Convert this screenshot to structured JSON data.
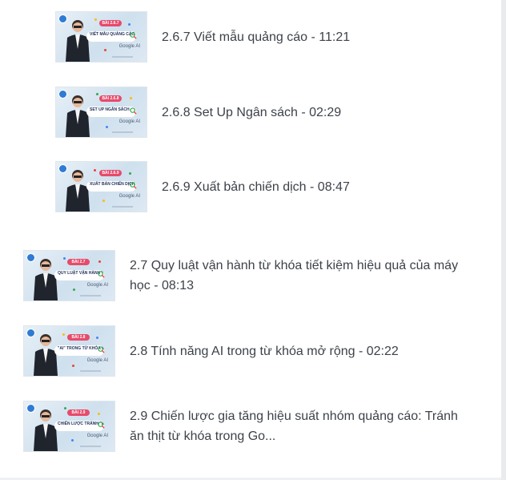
{
  "lessons": [
    {
      "title": "2.6.7 Viết mẫu quảng cáo - 11:21",
      "thumb_badge": "BÀI 2.6.7",
      "thumb_title": "VIẾT MẪU QUẢNG CÁO HIỆU QUẢ",
      "thumb_brand": "Google AI"
    },
    {
      "title": "2.6.8 Set Up Ngân sách - 02:29",
      "thumb_badge": "BÀI 2.6.8",
      "thumb_title": "SET UP NGÂN SÁCH",
      "thumb_brand": "Google AI"
    },
    {
      "title": "2.6.9 Xuất bản chiến dịch - 08:47",
      "thumb_badge": "BÀI 2.6.9",
      "thumb_title": "XUẤT BẢN CHIẾN DỊCH",
      "thumb_brand": "Google AI"
    },
    {
      "title_line1": "2.7 Quy luật vận hành từ khóa tiết kiệm hiệu quả của máy",
      "title_line2": "học - 08:13",
      "thumb_badge": "BÀI 2.7",
      "thumb_title": "QUY LUẬT VẬN HÀNH TỪ KHÓA HIỆU QUẢ",
      "thumb_brand": "Google AI"
    },
    {
      "title": "2.8 Tính năng AI trong từ khóa mở rộng - 02:22",
      "thumb_badge": "BÀI 2.8",
      "thumb_title": "\"AI\" TRONG TỪ KHÓA MỞ RỘNG",
      "thumb_brand": "Google AI"
    },
    {
      "title_line1": "2.9 Chiến lược gia tăng hiệu suất nhóm quảng cáo: Tránh",
      "title_line2": "ăn thịt từ khóa trong Go...",
      "thumb_badge": "BÀI 2.9",
      "thumb_title": "CHIẾN LƯỢC TRÁNH \"ĂN THỊT\" TỪ KHÓA",
      "thumb_brand": "Google AI"
    }
  ]
}
